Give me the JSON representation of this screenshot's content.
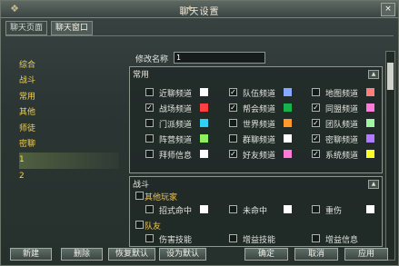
{
  "window": {
    "title": "聊天设置",
    "close_symbol": "×"
  },
  "tabs": [
    {
      "label": "聊天页面"
    },
    {
      "label": "聊天窗口"
    }
  ],
  "left_list": [
    "综合",
    "战斗",
    "常用",
    "其他",
    "师徒",
    "密聊",
    "1",
    "2"
  ],
  "rename": {
    "label": "修改名称",
    "value": "1"
  },
  "common_panel": {
    "header": "常用",
    "channels": [
      {
        "label": "近聊频道",
        "checked": false,
        "color": "#ffffff"
      },
      {
        "label": "队伍频道",
        "checked": true,
        "color": "#86a8ff"
      },
      {
        "label": "地图频道",
        "checked": false,
        "color": "#ff7f7f"
      },
      {
        "label": "战场频道",
        "checked": true,
        "color": "#ff4040"
      },
      {
        "label": "帮会频道",
        "checked": true,
        "color": "#18b24c"
      },
      {
        "label": "同盟频道",
        "checked": true,
        "color": "#ff7ad9"
      },
      {
        "label": "门派频道",
        "checked": false,
        "color": "#2ed2f2"
      },
      {
        "label": "世界频道",
        "checked": false,
        "color": "#ff9a2a"
      },
      {
        "label": "团队频道",
        "checked": true,
        "color": "#a0f5a0"
      },
      {
        "label": "阵营频道",
        "checked": false,
        "color": "#8ef060"
      },
      {
        "label": "群聊频道",
        "checked": false,
        "color": "#ffffff"
      },
      {
        "label": "密聊频道",
        "checked": true,
        "color": "#b17bff"
      },
      {
        "label": "拜师信息",
        "checked": false,
        "color": "#ffffff"
      },
      {
        "label": "好友频道",
        "checked": true,
        "color": "#ff79d8"
      },
      {
        "label": "系统频道",
        "checked": true,
        "color": "#ffff25"
      }
    ]
  },
  "battle_panel": {
    "header": "战斗",
    "group1_title": "其他玩家",
    "group1_items": [
      {
        "label": "招式命中",
        "checked": false,
        "color": "#ffffff"
      },
      {
        "label": "未命中",
        "checked": false,
        "color": "#ffffff"
      },
      {
        "label": "重伤",
        "checked": false,
        "color": "#ffffff"
      }
    ],
    "group2_title": "队友",
    "group2_items": [
      {
        "label": "伤害技能",
        "checked": false
      },
      {
        "label": "增益技能",
        "checked": false
      },
      {
        "label": "增益信息",
        "checked": false
      }
    ]
  },
  "buttons": {
    "new": "新建",
    "delete": "删除",
    "restore": "恢复默认",
    "set_default": "设为默认",
    "ok": "确定",
    "cancel": "取消",
    "apply": "应用"
  },
  "icons": {
    "close": "close-icon",
    "collapse": "chevron-up-icon",
    "checked": "checkmark-icon"
  }
}
